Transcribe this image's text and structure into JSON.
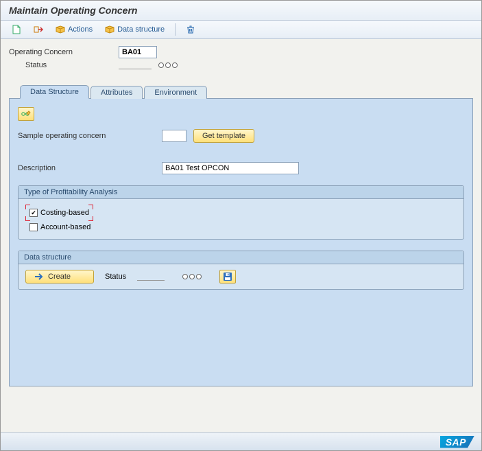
{
  "title": "Maintain Operating Concern",
  "toolbar": {
    "actions_label": "Actions",
    "data_structure_label": "Data structure"
  },
  "header": {
    "operating_concern_label": "Operating Concern",
    "operating_concern_value": "BA01",
    "status_label": "Status"
  },
  "tabs": [
    {
      "label": "Data Structure"
    },
    {
      "label": "Attributes"
    },
    {
      "label": "Environment"
    }
  ],
  "panel": {
    "sample_label": "Sample operating concern",
    "sample_value": "",
    "get_template_label": "Get template",
    "description_label": "Description",
    "description_value": "BA01 Test OPCON",
    "profitability_box_title": "Type of Profitability Analysis",
    "costing_label": "Costing-based",
    "account_label": "Account-based",
    "datastruct_box_title": "Data structure",
    "create_label": "Create",
    "ds_status_label": "Status"
  },
  "footer": {
    "logo": "SAP"
  }
}
